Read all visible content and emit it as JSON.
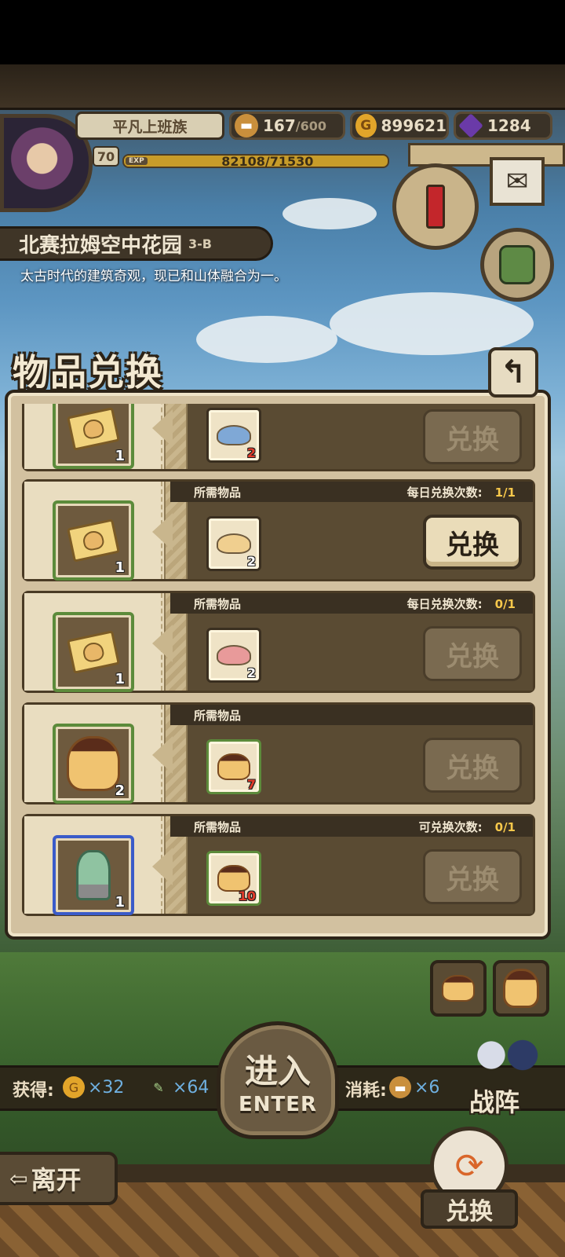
{
  "player": {
    "name": "平凡上班族",
    "level": "70",
    "exp_tag": "EXP",
    "exp_text": "82108/71530"
  },
  "resources": {
    "stamina": {
      "value": "167",
      "max": "/600",
      "icon": "bread-icon"
    },
    "gold": {
      "value": "899621",
      "icon": "gold-coin-icon"
    },
    "gem": {
      "value": "1284",
      "icon": "purple-gem-icon"
    }
  },
  "stage": {
    "name": "北赛拉姆空中花园",
    "code": "3-B",
    "description": "太古时代的建筑奇观，现已和山体融合为一。"
  },
  "exchange": {
    "title": "物品兑换",
    "back_icon": "return-arrow-icon",
    "required_label": "所需物品",
    "rows": [
      {
        "reward_qty": "1",
        "need_qty": "2",
        "need_qty_color": "red",
        "reward": "ticket",
        "need": "blue-slime",
        "button": "兑换",
        "active": false,
        "header": false
      },
      {
        "reward_qty": "1",
        "need_qty": "2",
        "need_qty_color": "white",
        "reward": "ticket",
        "need": "yellow-slime",
        "button": "兑换",
        "active": true,
        "header": true,
        "limit_label": "每日兑换次数:",
        "limit_value": "1/1"
      },
      {
        "reward_qty": "1",
        "need_qty": "2",
        "need_qty_color": "white",
        "reward": "ticket",
        "need": "pink-slime",
        "button": "兑换",
        "active": false,
        "header": true,
        "limit_label": "每日兑换次数:",
        "limit_value": "0/1"
      },
      {
        "reward_qty": "2",
        "need_qty": "7",
        "need_qty_color": "red",
        "reward": "pudding",
        "need": "small-pudding",
        "button": "兑换",
        "active": false,
        "header": true,
        "limit_label": "",
        "limit_value": ""
      },
      {
        "reward_qty": "1",
        "need_qty": "10",
        "need_qty_color": "red",
        "reward": "statue",
        "need": "small-pudding",
        "button": "兑换",
        "active": false,
        "header": true,
        "limit_label": "可兑换次数:",
        "limit_value": "0/1"
      }
    ]
  },
  "rewards_bar": {
    "gain_label": "获得:",
    "gold_amount": "×32",
    "feather_amount": "×64",
    "cost_label": "消耗:",
    "bread_amount": "×6"
  },
  "buttons": {
    "enter_zh": "进入",
    "enter_en": "ENTER",
    "formation": "战阵",
    "leave": "离开",
    "leave_arrow": "⇦",
    "exchange": "兑换"
  },
  "colors": {
    "accent_gold": "#f7c84b",
    "wood_dark": "#2d2418",
    "parchment": "#e6d8b9",
    "need_red": "#e23a2a"
  }
}
